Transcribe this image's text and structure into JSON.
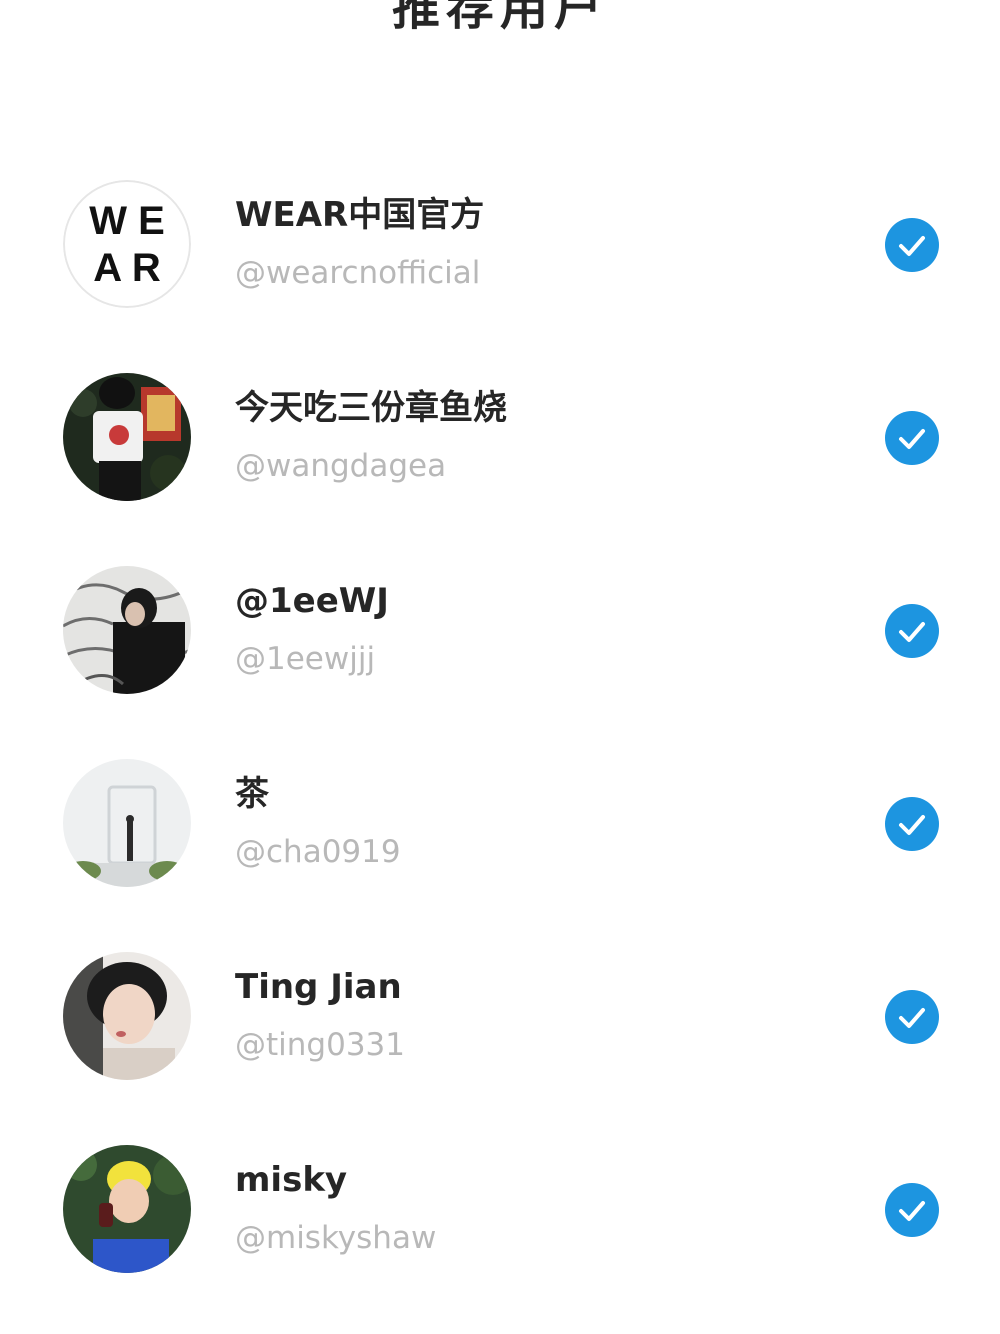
{
  "header": {
    "title": "推荐用户"
  },
  "accent_color": "#1d95e0",
  "users": [
    {
      "name": "WEAR中国官方",
      "handle": "@wearcnofficial",
      "selected": true,
      "avatar_icon": "wear-logo-avatar"
    },
    {
      "name": "今天吃三份章鱼烧",
      "handle": "@wangdagea",
      "selected": true,
      "avatar_icon": "photo-avatar"
    },
    {
      "name": "@1eeWJ",
      "handle": "@1eewjjj",
      "selected": true,
      "avatar_icon": "photo-avatar"
    },
    {
      "name": "茶",
      "handle": "@cha0919",
      "selected": true,
      "avatar_icon": "photo-avatar"
    },
    {
      "name": "Ting Jian",
      "handle": "@ting0331",
      "selected": true,
      "avatar_icon": "photo-avatar"
    },
    {
      "name": "misky",
      "handle": "@miskyshaw",
      "selected": true,
      "avatar_icon": "photo-avatar"
    }
  ],
  "avatar_logo_text": {
    "line1": "W E",
    "line2": "A R"
  }
}
